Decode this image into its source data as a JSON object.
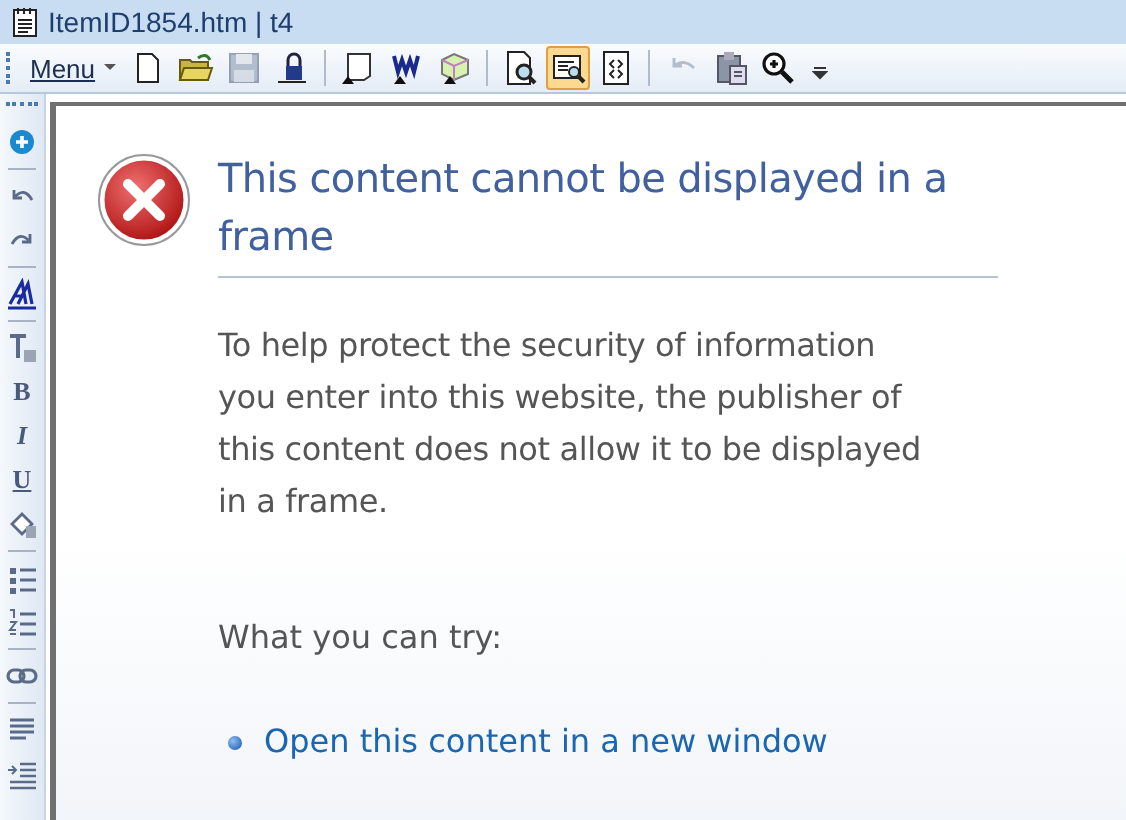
{
  "window": {
    "title": "ItemID1854.htm | t4"
  },
  "toolbar": {
    "menu": {
      "label": "Menu"
    },
    "groups": [
      [
        {
          "selected": false,
          "disabled": false
        },
        {
          "selected": false,
          "disabled": false
        },
        {
          "selected": false,
          "disabled": true
        },
        {
          "selected": false,
          "disabled": false
        }
      ],
      [
        {
          "selected": false,
          "disabled": false
        },
        {
          "selected": false,
          "disabled": false
        },
        {
          "selected": false,
          "disabled": false
        }
      ],
      [
        {
          "selected": false,
          "disabled": false
        },
        {
          "selected": true,
          "disabled": false
        },
        {
          "selected": false,
          "disabled": false
        }
      ],
      [
        {
          "selected": false,
          "disabled": true
        },
        {
          "selected": false,
          "disabled": false
        },
        {
          "selected": false,
          "disabled": false
        }
      ]
    ]
  },
  "side_toolbar": {
    "groups": [
      [
        {
          "kind": "icon"
        }
      ],
      [
        {
          "kind": "icon"
        },
        {
          "kind": "icon"
        }
      ],
      [
        {
          "kind": "icon"
        }
      ],
      [
        {
          "kind": "icon"
        },
        {
          "kind": "bold",
          "label": "B"
        },
        {
          "kind": "italic",
          "label": "I"
        },
        {
          "kind": "underline",
          "label": "U"
        },
        {
          "kind": "icon"
        }
      ],
      [
        {
          "kind": "icon"
        },
        {
          "kind": "icon"
        }
      ],
      [
        {
          "kind": "icon"
        }
      ],
      [
        {
          "kind": "icon"
        },
        {
          "kind": "icon"
        }
      ]
    ]
  },
  "message": {
    "heading": "This content cannot be displayed in a frame",
    "body": "To help protect the security of information you enter into this website, the publisher of this content does not allow it to be displayed in a frame.",
    "subheading": "What you can try:",
    "links": [
      "Open this content in a new window"
    ]
  }
}
